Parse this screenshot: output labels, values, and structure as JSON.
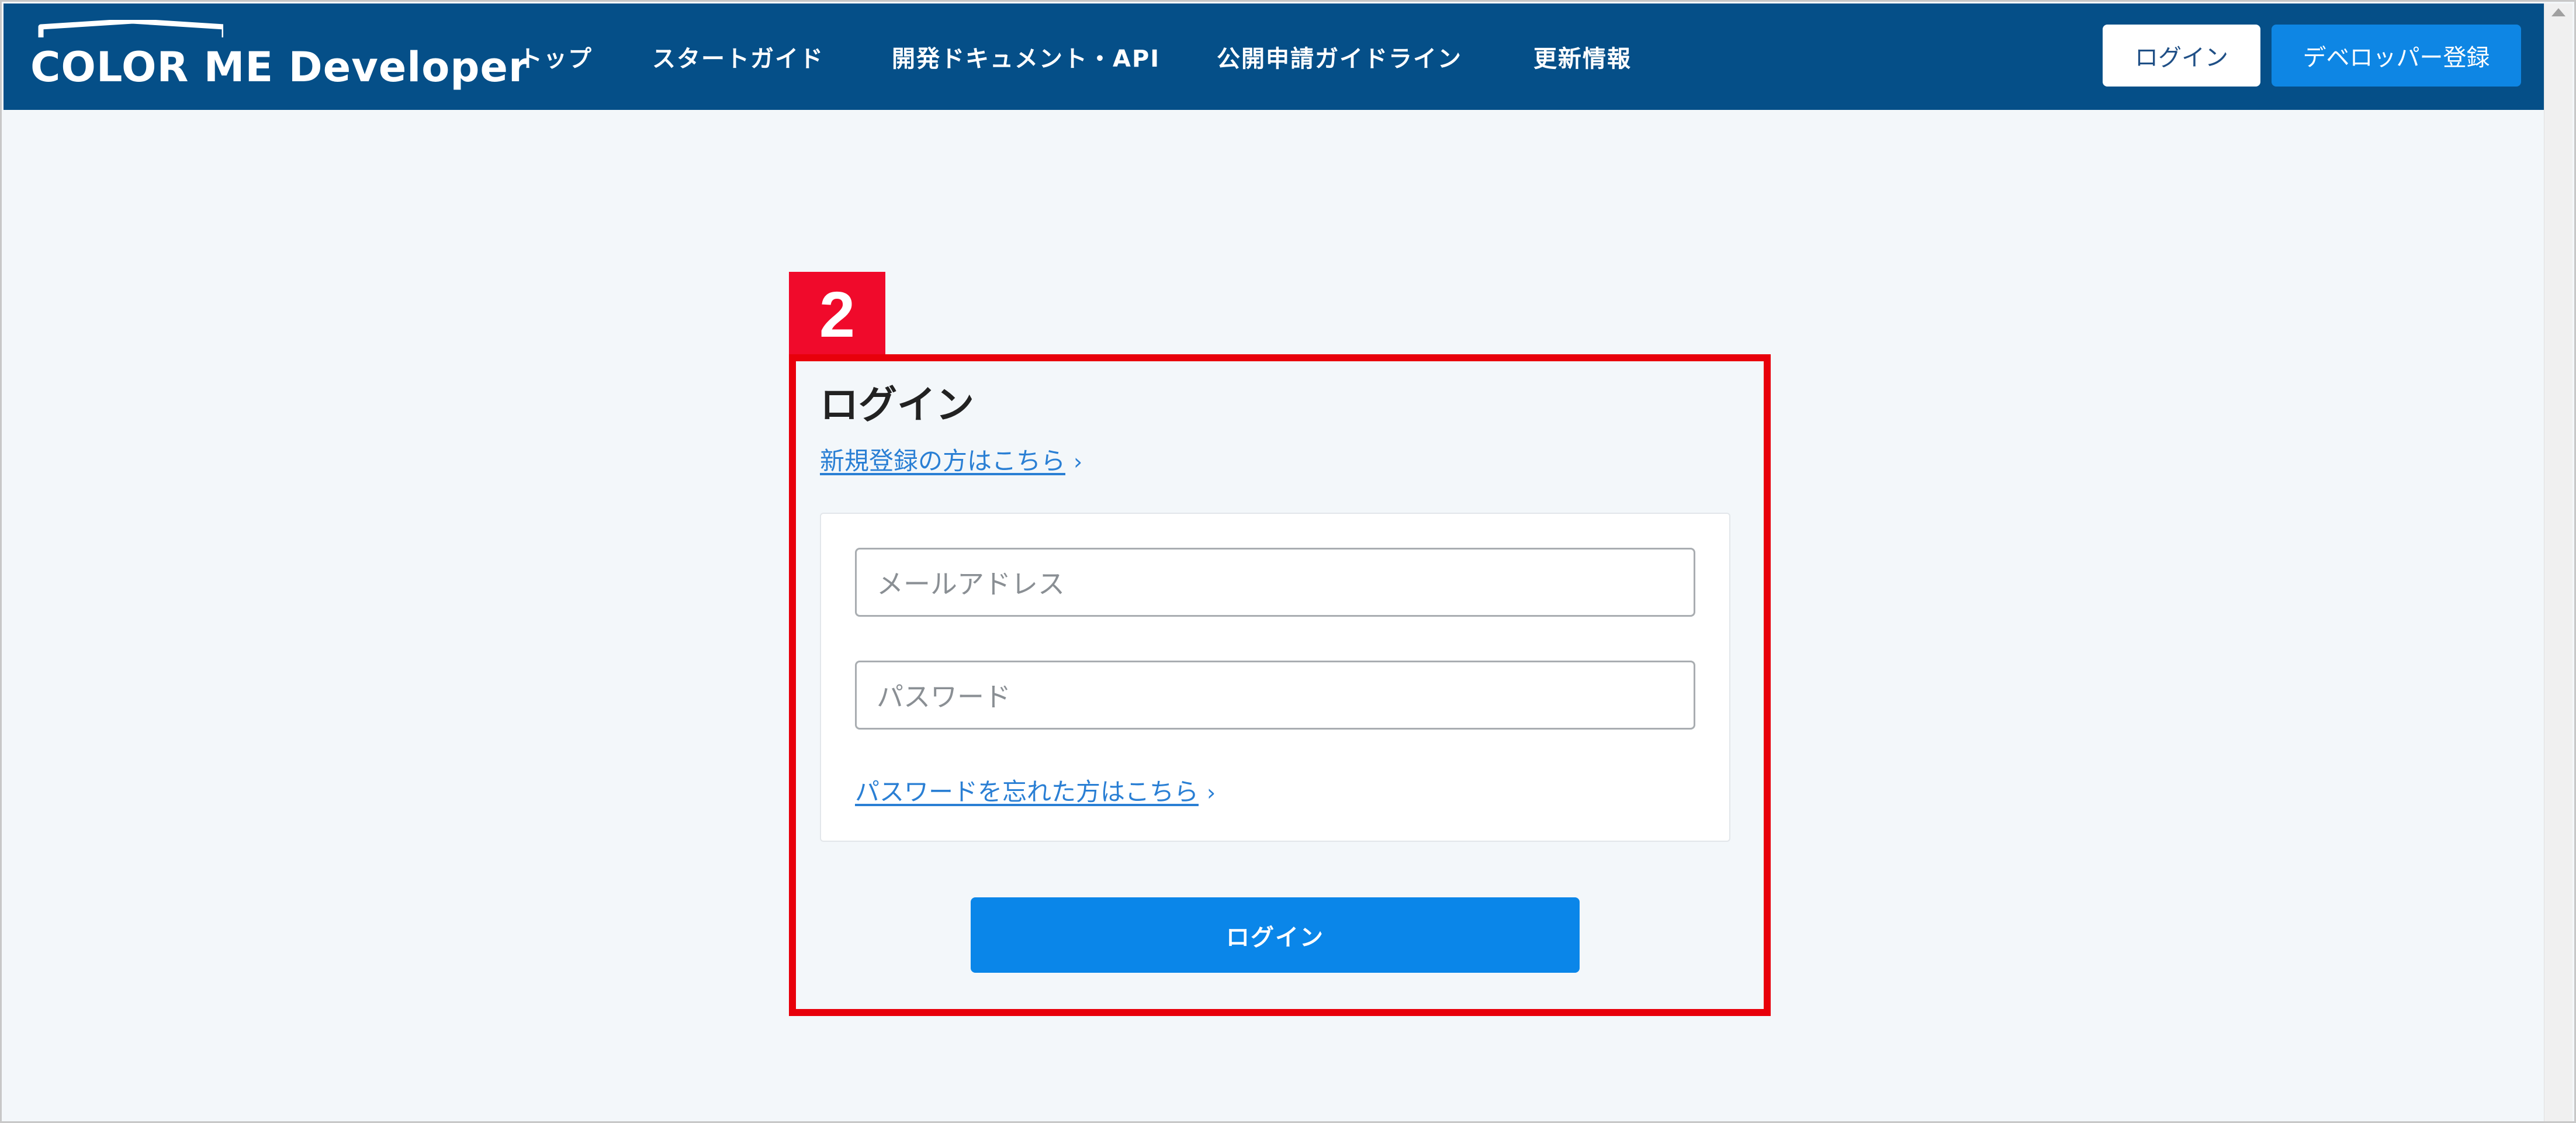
{
  "header": {
    "logo_text": "COLOR ME Developer",
    "nav": [
      "トップ",
      "スタートガイド",
      "開発ドキュメント・API",
      "公開申請ガイドライン",
      "更新情報"
    ],
    "login_button": "ログイン",
    "register_button": "デベロッパー登録",
    "background_color": "#054f88"
  },
  "annotation": {
    "badge_number": "2",
    "highlight_color": "#e8000b"
  },
  "login": {
    "title": "ログイン",
    "signup_link": "新規登録の方はこちら",
    "email_placeholder": "メールアドレス",
    "password_placeholder": "パスワード",
    "forgot_link": "パスワードを忘れた方はこちら",
    "submit_button": "ログイン",
    "link_chevron": "›",
    "accent_color": "#0a86e9"
  }
}
